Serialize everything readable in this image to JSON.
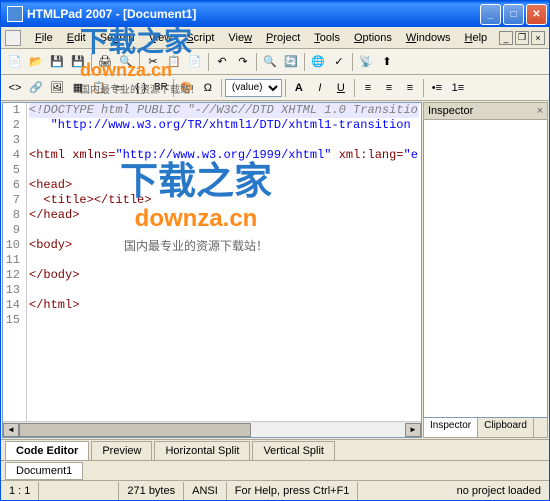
{
  "title": "HTMLPad 2007 - [Document1]",
  "menus": [
    "File",
    "Edit",
    "Search",
    "View",
    "Script",
    "View",
    "Project",
    "Tools",
    "Options",
    "Windows",
    "Help"
  ],
  "toolbar1_labels": {
    "br": "BR",
    "cln": "{ }"
  },
  "format_dd": "(value)",
  "gutter_lines": [
    "1",
    "2",
    "3",
    "4",
    "5",
    "6",
    "7",
    "8",
    "9",
    "10",
    "11",
    "12",
    "13",
    "14",
    "15"
  ],
  "code_lines": [
    {
      "hl": true,
      "html": "<span class='c-comment'>&lt;!DOCTYPE html PUBLIC \"-//W3C//DTD XHTML 1.0 Transitio</span>"
    },
    {
      "html": "   <span class='c-str'>\"http://www.w3.org/TR/xhtml1/DTD/xhtml1-transition</span>"
    },
    {
      "html": ""
    },
    {
      "html": "<span class='c-tag'>&lt;html</span> <span class='c-attr'>xmlns=</span><span class='c-str'>\"http://www.w3.org/1999/xhtml\"</span> <span class='c-attr'>xml:lang=</span><span class='c-str'>\"e</span>"
    },
    {
      "html": ""
    },
    {
      "html": "<span class='c-tag'>&lt;head&gt;</span>"
    },
    {
      "html": "  <span class='c-tag'>&lt;title&gt;&lt;/title&gt;</span>"
    },
    {
      "html": "<span class='c-tag'>&lt;/head&gt;</span>"
    },
    {
      "html": ""
    },
    {
      "html": "<span class='c-tag'>&lt;body&gt;</span>"
    },
    {
      "html": ""
    },
    {
      "html": "<span class='c-tag'>&lt;/body&gt;</span>"
    },
    {
      "html": ""
    },
    {
      "html": "<span class='c-tag'>&lt;/html&gt;</span>"
    },
    {
      "html": ""
    }
  ],
  "inspector": {
    "title": "Inspector",
    "tabs": [
      "Inspector",
      "Clipboard"
    ]
  },
  "view_tabs": [
    "Code Editor",
    "Preview",
    "Horizontal Split",
    "Vertical Split"
  ],
  "doc_tab": "Document1",
  "status": {
    "pos": "1 : 1",
    "size": "271 bytes",
    "enc": "ANSI",
    "help": "For Help, press Ctrl+F1",
    "proj": "no project loaded"
  },
  "watermark": {
    "cn": "下载之家",
    "en": "downza.cn",
    "sub": "国内最专业的资源下载站！"
  }
}
